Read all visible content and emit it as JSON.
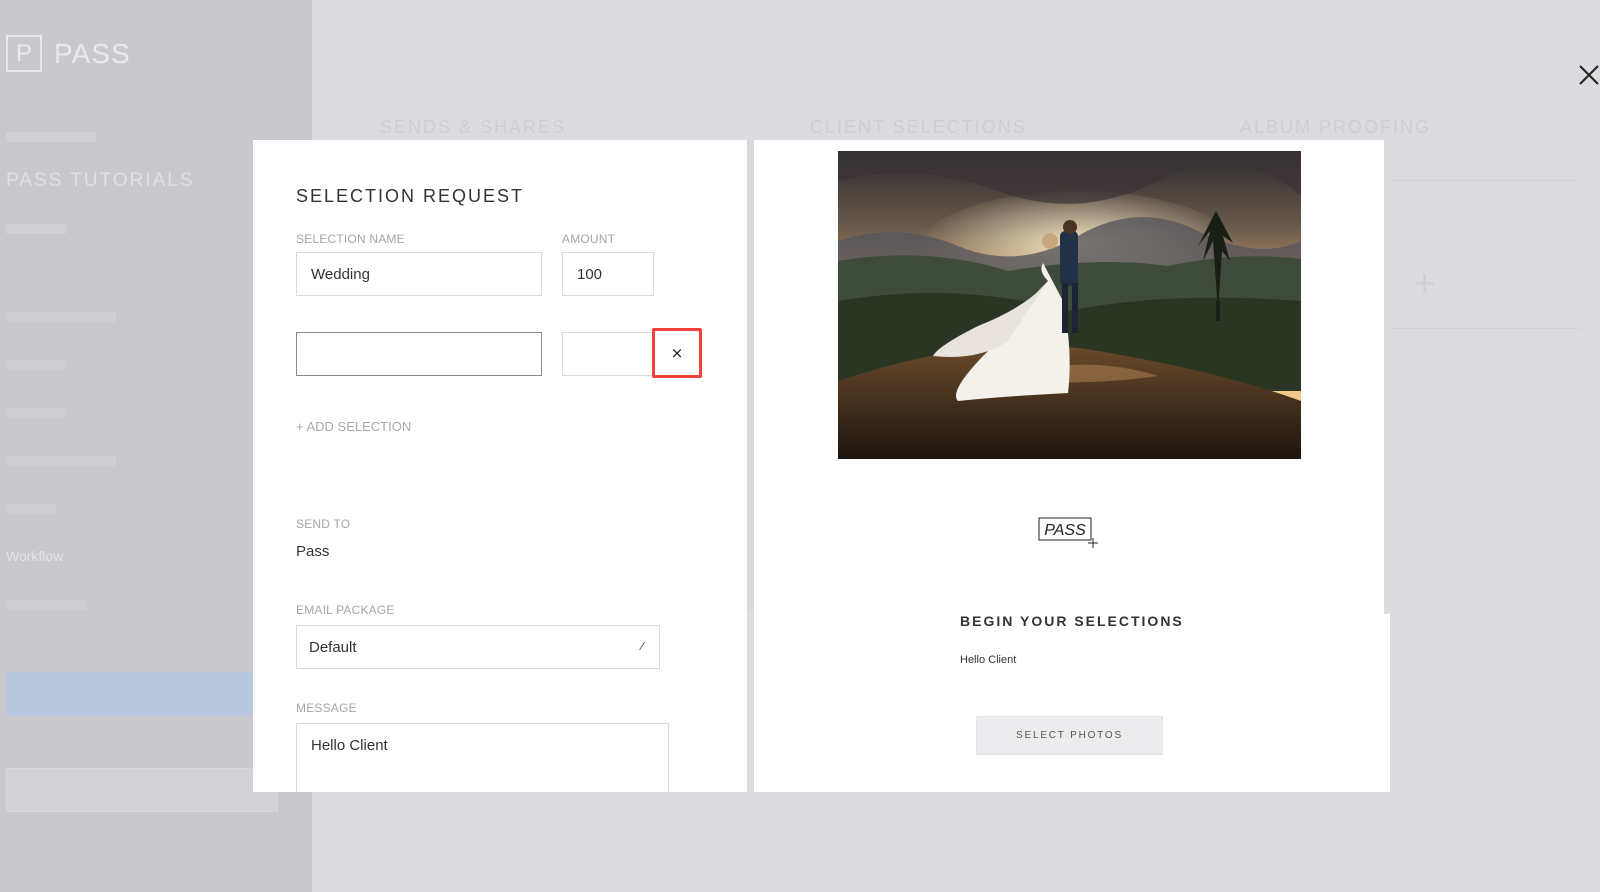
{
  "background_app": {
    "logo_letter": "P",
    "logo_text": "PASS",
    "gallery_title": "PASS TUTORIALS",
    "sidebar_workflow": "Workflow",
    "tabs": [
      "SENDS & SHARES",
      "CLIENT SELECTIONS",
      "ALBUM PROOFING"
    ]
  },
  "form": {
    "title": "SELECTION REQUEST",
    "selection_name_label": "SELECTION NAME",
    "amount_label": "AMOUNT",
    "rows": [
      {
        "name": "Wedding",
        "amount": "100"
      },
      {
        "name": "",
        "amount": ""
      }
    ],
    "remove_icon": "×",
    "add_selection": "+ ADD SELECTION",
    "send_to_label": "SEND TO",
    "send_to_value": "Pass",
    "email_package_label": "EMAIL PACKAGE",
    "email_package_value": "Default",
    "message_label": "MESSAGE",
    "message_value": "Hello Client"
  },
  "preview": {
    "logo_text": "PASS",
    "heading": "BEGIN YOUR SELECTIONS",
    "message": "Hello Client",
    "button_label": "SELECT PHOTOS"
  },
  "colors": {
    "highlight": "#f0413a",
    "overlay": "#dcdbdf"
  }
}
